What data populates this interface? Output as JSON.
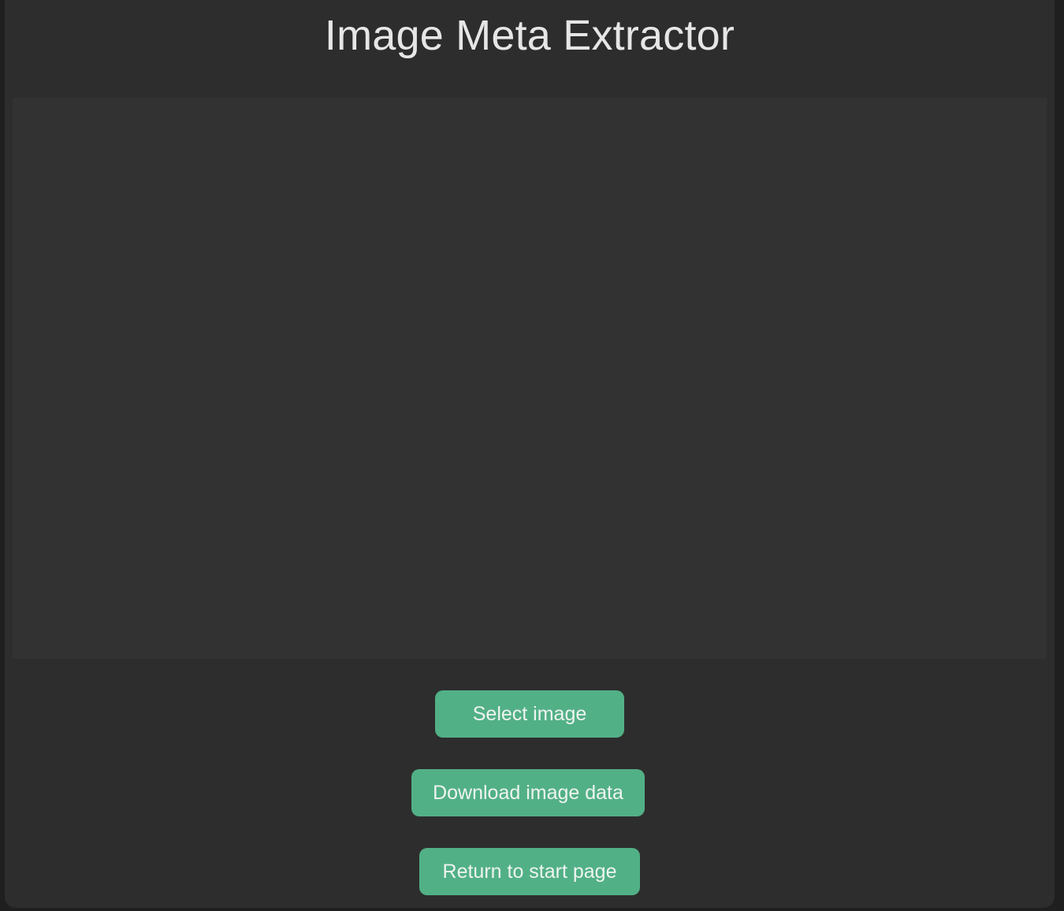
{
  "app": {
    "title": "Image Meta Extractor"
  },
  "buttons": {
    "select_image": "Select image",
    "download_image_data": "Download image data",
    "return_to_start": "Return to start page"
  },
  "colors": {
    "background": "#2d2d2d",
    "preview_background": "#323232",
    "accent": "#52b086",
    "title_text": "#e6e6e6"
  }
}
